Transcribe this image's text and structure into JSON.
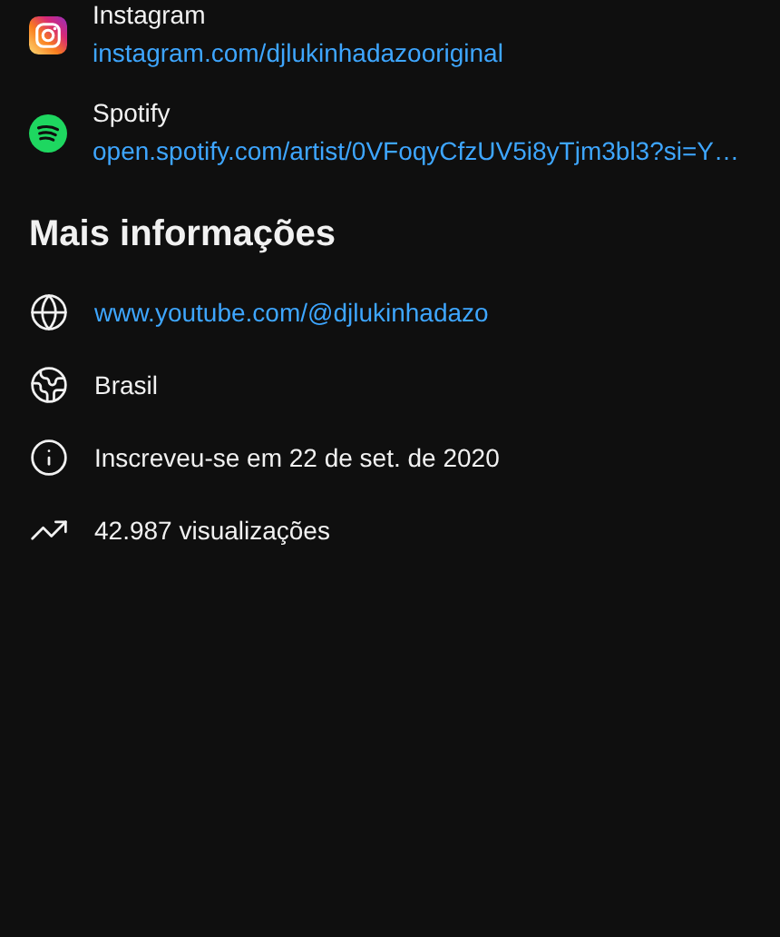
{
  "links": [
    {
      "kind": "instagram",
      "title": "Instagram",
      "url": "instagram.com/djlukinhadazooriginal"
    },
    {
      "kind": "spotify",
      "title": "Spotify",
      "url": "open.spotify.com/artist/0VFoqyCfzUV5i8yTjm3bl3?si=Y…"
    }
  ],
  "more_info": {
    "title": "Mais informações",
    "items": [
      {
        "kind": "website",
        "text": "www.youtube.com/@djlukinhadazo"
      },
      {
        "kind": "country",
        "text": "Brasil"
      },
      {
        "kind": "joined",
        "text": "Inscreveu-se em 22 de set. de 2020"
      },
      {
        "kind": "views",
        "text": "42.987 visualizações"
      }
    ]
  }
}
